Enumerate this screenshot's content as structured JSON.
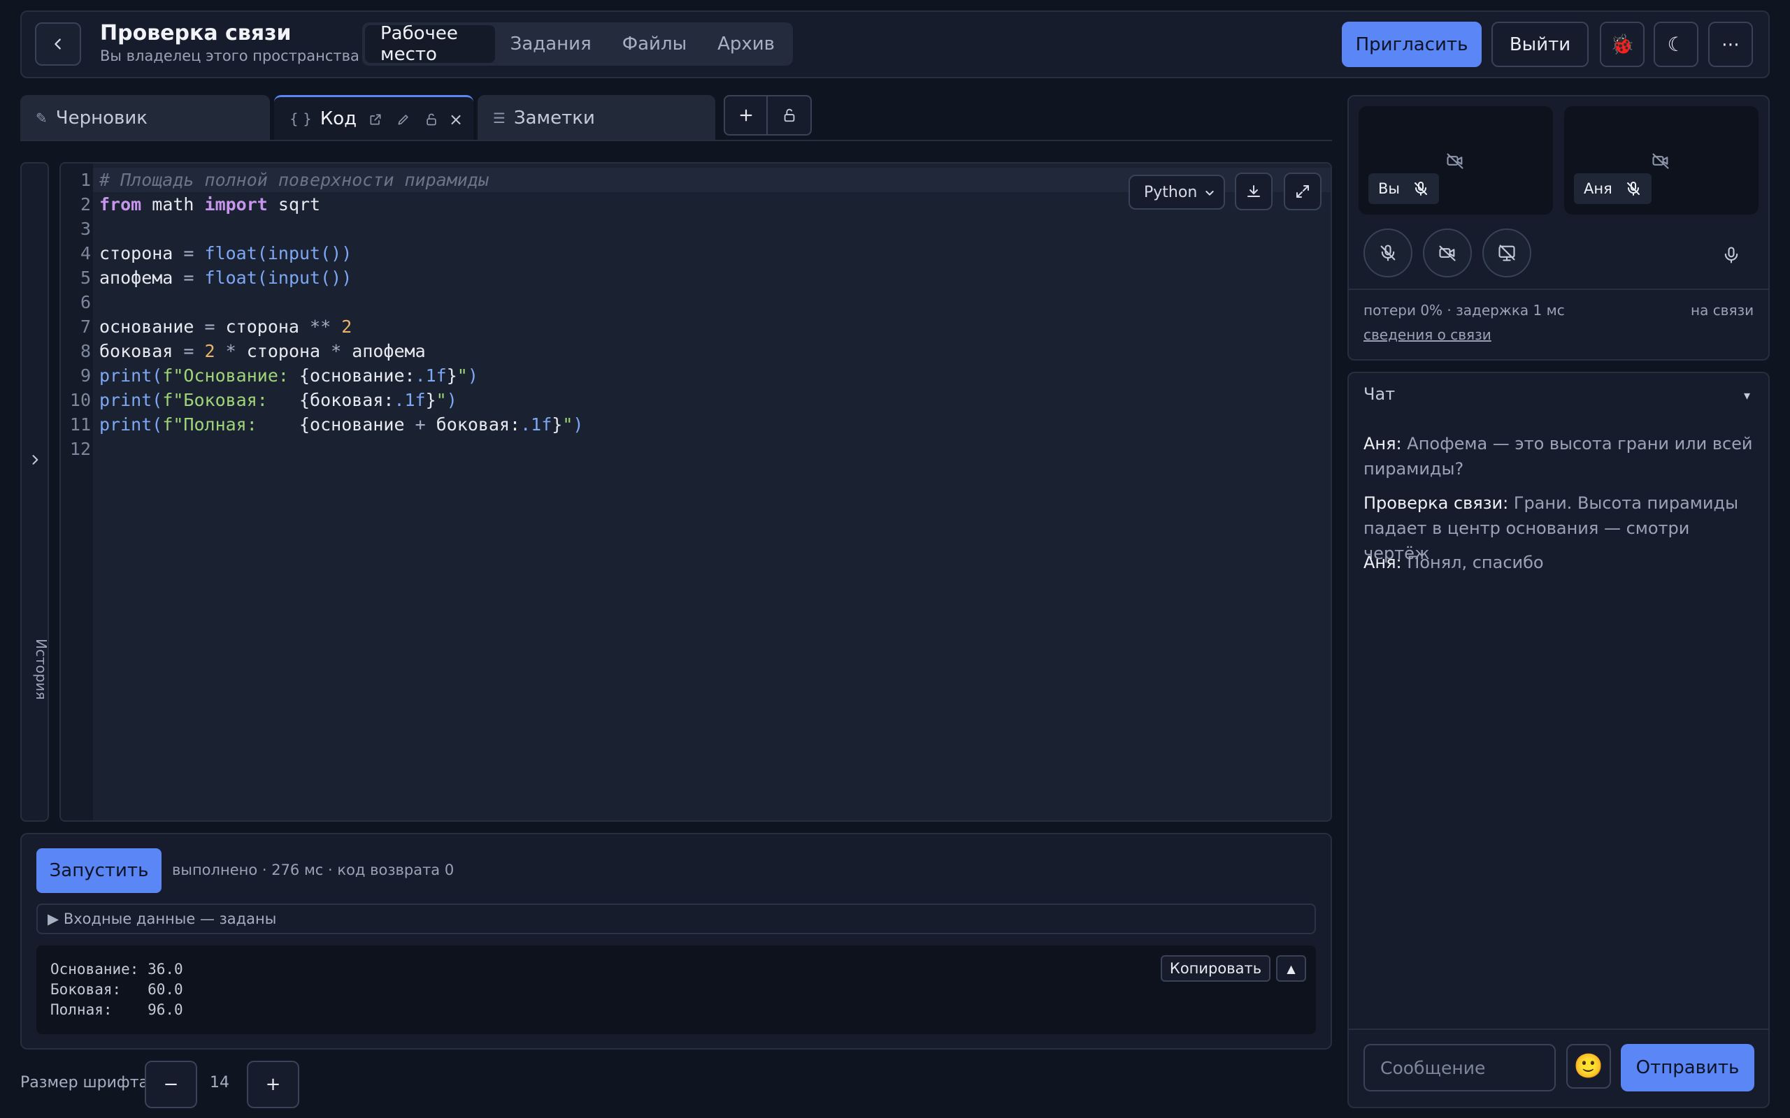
{
  "header": {
    "title": "Проверка связи",
    "subtitle": "Вы владелец этого пространства",
    "nav": [
      "Рабочее место",
      "Задания",
      "Файлы",
      "Архив"
    ],
    "invite_label": "Пригласить",
    "exit_label": "Выйти",
    "bug_icon": "🐞",
    "theme_icon": "☾",
    "more_icon": "⋯"
  },
  "tabs": {
    "draft": {
      "icon": "✎",
      "label": "Черновик"
    },
    "code": {
      "icon": "{ }",
      "label": "Код"
    },
    "notes": {
      "icon": "☰",
      "label": "Заметки"
    },
    "close_glyph": "×"
  },
  "history_label": "История",
  "editor": {
    "language": "Python",
    "line_numbers": [
      "1",
      "2",
      "3",
      "4",
      "5",
      "6",
      "7",
      "8",
      "9",
      "10",
      "11",
      "12"
    ]
  },
  "run": {
    "button": "Запустить",
    "status": "выполнено · 276 мс · код возврата 0",
    "inputs_label": "▶  Входные данные — заданы",
    "output": "Основание: 36.0\nБоковая:   60.0\nПолная:    96.0",
    "copy_label": "Копировать",
    "collapse_glyph": "▲"
  },
  "font": {
    "label": "Размер шрифта",
    "minus": "−",
    "value": "14",
    "plus": "+"
  },
  "call": {
    "you_label": "Вы",
    "peer_label": "Аня",
    "stats": "потери 0% · задержка 1 мс",
    "state": "на связи",
    "details_link": "сведения о связи"
  },
  "chat": {
    "title": "Чат",
    "caret": "▾",
    "messages": [
      {
        "author": "Аня:",
        "text": "Апофема — это высота грани или всей пирамиды?"
      },
      {
        "author": "Проверка связи:",
        "text": "Грани. Высота пирамиды падает в центр основания — смотри чертёж"
      },
      {
        "author": "Аня:",
        "text": "Понял, спасибо"
      }
    ],
    "placeholder": "Сообщение",
    "emoji": "🙂",
    "send_label": "Отправить"
  },
  "colors": {
    "accent": "#5b86f5",
    "background": "#0f1421",
    "panel": "#161c2b"
  }
}
